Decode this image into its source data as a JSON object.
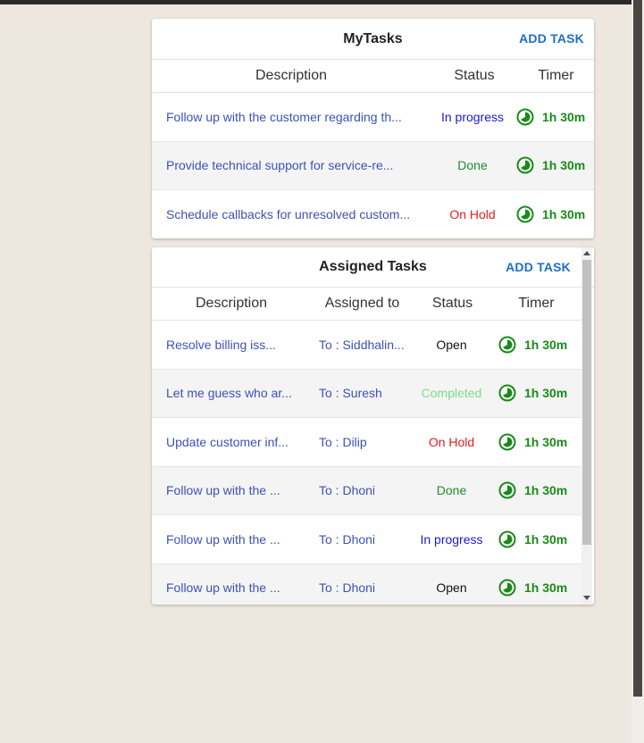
{
  "colors": {
    "background": "#ede7df",
    "accent": "#1f6fc5",
    "link": "#3f51b5",
    "timer_green": "#1a8a1a",
    "status_in_progress": "#1a1acc",
    "status_done": "#1e8c2e",
    "status_on_hold": "#e81c1c",
    "status_open": "#111111",
    "status_completed": "#7ddc86"
  },
  "mytasks": {
    "title": "MyTasks",
    "add_label": "ADD TASK",
    "headers": {
      "description": "Description",
      "status": "Status",
      "timer": "Timer"
    },
    "rows": [
      {
        "description": "Follow up with the customer regarding th...",
        "status": "In progress",
        "timer": "1h 30m",
        "timer_icon": "clock-icon"
      },
      {
        "description": "Provide technical support for service-re...",
        "status": "Done",
        "timer": "1h 30m",
        "timer_icon": "clock-icon"
      },
      {
        "description": "Schedule callbacks for unresolved custom...",
        "status": "On Hold",
        "timer": "1h 30m",
        "timer_icon": "clock-icon"
      }
    ]
  },
  "assigned": {
    "title": "Assigned Tasks",
    "add_label": "ADD TASK",
    "headers": {
      "description": "Description",
      "assigned_to": "Assigned to",
      "status": "Status",
      "timer": "Timer"
    },
    "rows": [
      {
        "description": "Resolve billing iss...",
        "assigned_to": "To : Siddhalin...",
        "status": "Open",
        "timer": "1h 30m"
      },
      {
        "description": "Let me guess who ar...",
        "assigned_to": "To : Suresh",
        "status": "Completed",
        "timer": "1h 30m"
      },
      {
        "description": "Update customer inf...",
        "assigned_to": "To : Dilip",
        "status": "On Hold",
        "timer": "1h 30m"
      },
      {
        "description": "Follow up with the ...",
        "assigned_to": "To : Dhoni",
        "status": "Done",
        "timer": "1h 30m"
      },
      {
        "description": "Follow up with the ...",
        "assigned_to": "To : Dhoni",
        "status": "In progress",
        "timer": "1h 30m"
      },
      {
        "description": "Follow up with the ...",
        "assigned_to": "To : Dhoni",
        "status": "Open",
        "timer": "1h 30m"
      }
    ]
  }
}
